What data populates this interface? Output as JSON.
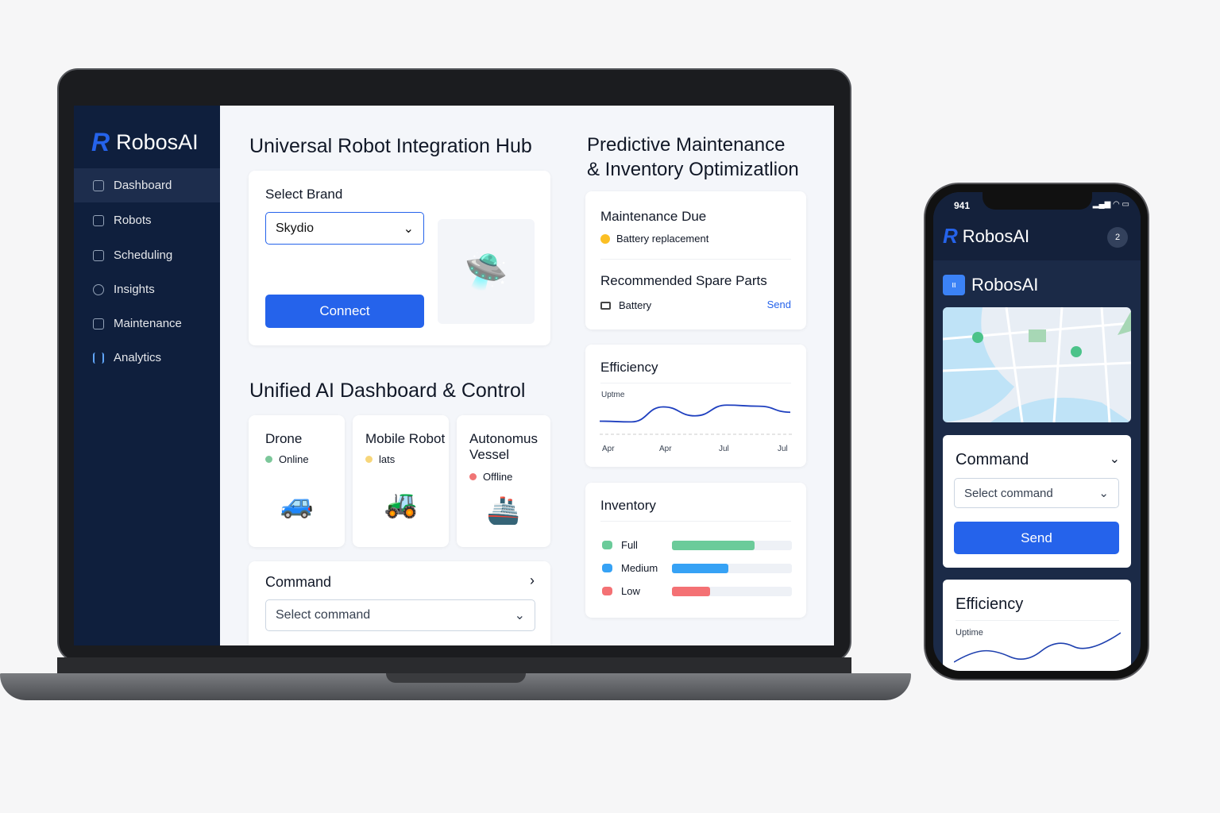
{
  "sidebar": {
    "brand": "RobosAI",
    "items": [
      {
        "label": "Dashboard",
        "icon": "home-icon"
      },
      {
        "label": "Robots",
        "icon": "robot-icon"
      },
      {
        "label": "Scheduling",
        "icon": "calendar-icon"
      },
      {
        "label": "Insights",
        "icon": "insights-icon"
      },
      {
        "label": "Maintenance",
        "icon": "wrench-icon"
      },
      {
        "label": "Analytics",
        "icon": "bar-chart-icon"
      }
    ]
  },
  "hub": {
    "title": "Universal Robot Integration Hub",
    "select_label": "Select Brand",
    "brand_value": "Skydio",
    "connect": "Connect"
  },
  "dashboard": {
    "title": "Unified AI Dashboard & Control",
    "robots": [
      {
        "name": "Drone",
        "status": "Online",
        "color": "#7cc79a"
      },
      {
        "name": "Mobile Robot",
        "status": "lats",
        "color": "#f7d67a"
      },
      {
        "name": "Autonomus Vessel",
        "status": "Offline",
        "color": "#f07575"
      }
    ],
    "command": {
      "title": "Command",
      "placeholder": "Select command"
    }
  },
  "maintenance": {
    "title_line1": "Predictive Maintenance",
    "title_line2": "& Inventory Optimizatlion",
    "due_title": "Maintenance Due",
    "due_item": "Battery replacement",
    "parts_title": "Recommended Spare Parts",
    "part_item": "Battery",
    "send": "Send"
  },
  "chart_data": [
    {
      "type": "line",
      "title": "Efficiency",
      "ylabel": "Uptme",
      "categories": [
        "Apr",
        "Apr",
        "Jul",
        "Jul"
      ],
      "series": [
        {
          "values": [
            0.3,
            0.28,
            0.7,
            0.45,
            0.75,
            0.72,
            0.55
          ]
        }
      ],
      "grid": false
    },
    {
      "type": "bar",
      "title": "Inventory",
      "categories": [
        "Full",
        "Medium",
        "Low"
      ],
      "values": [
        0.69,
        0.47,
        0.32
      ],
      "colors": [
        "#6bcb9a",
        "#36a2f5",
        "#f47174"
      ]
    }
  ],
  "phone": {
    "time": "941",
    "brand": "RobosAI",
    "badge": "2",
    "app_title": "RobosAI",
    "command_title": "Command",
    "command_placeholder": "Select command",
    "send": "Send",
    "efficiency_title": "Efficiency",
    "uptime_label": "Uptime"
  }
}
